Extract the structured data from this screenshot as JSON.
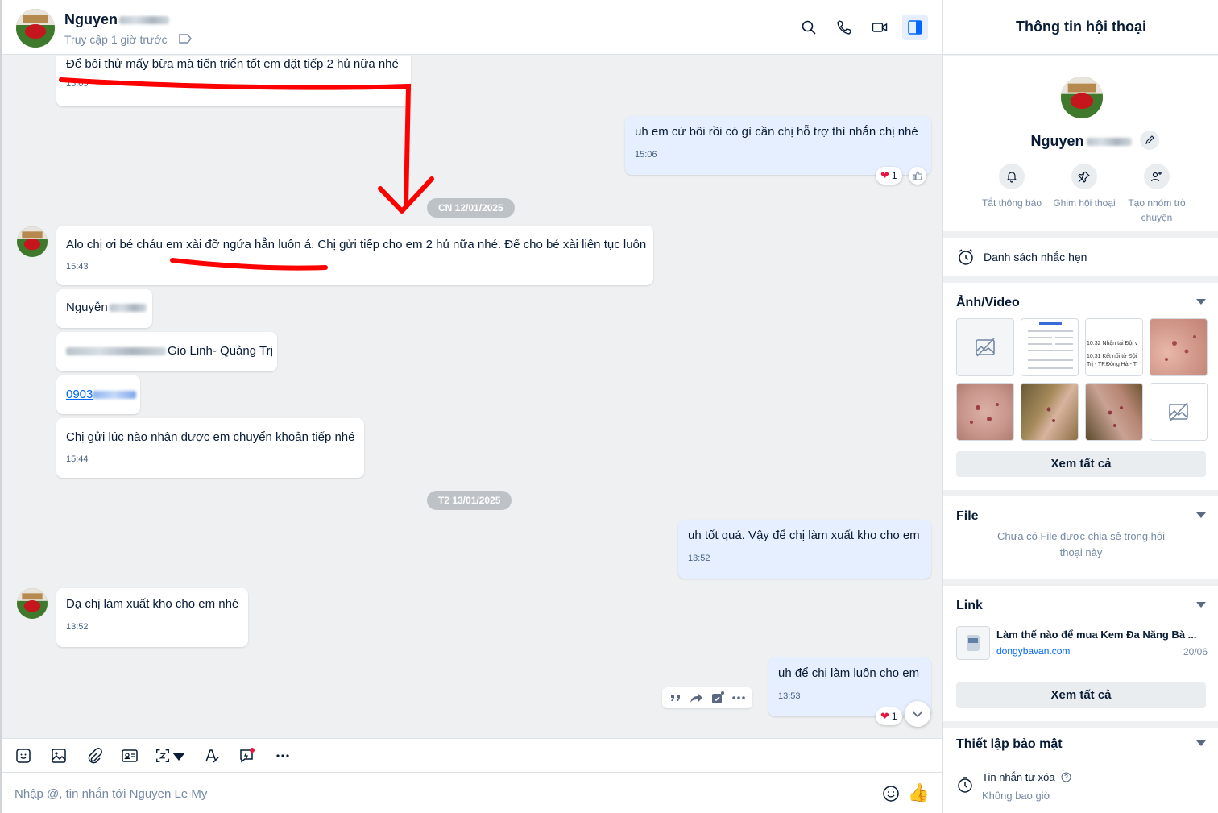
{
  "header": {
    "name": "Nguyen",
    "status": "Truy cập 1 giờ trước"
  },
  "messages": {
    "m1": {
      "text": "Để bôi thử mấy bữa mà tiến triển tốt em đặt tiếp 2 hủ nữa nhé",
      "time": "15:05"
    },
    "m2": {
      "text": "uh em cứ bôi rồi có gì cần chị hỗ trợ thì nhắn chị nhé",
      "time": "15:06",
      "reaction_count": "1"
    },
    "date1": "CN 12/01/2025",
    "m3": {
      "text": "Alo chị ơi bé cháu em xài đỡ ngứa hẳn luôn á. Chị gửi tiếp cho em 2 hủ nữa nhé.  Để cho bé xài liên tục luôn",
      "time": "15:43"
    },
    "m4": {
      "text": "Nguyễn"
    },
    "m5": {
      "text": "Gio Linh- Quảng Trị"
    },
    "m6": {
      "text": "0903"
    },
    "m7": {
      "text": "Chị gửi lúc nào nhận được em chuyển khoản tiếp nhé",
      "time": "15:44"
    },
    "date2": "T2 13/01/2025",
    "m8": {
      "text": "uh tốt quá. Vậy để chị làm xuất kho cho em",
      "time": "13:52"
    },
    "m9": {
      "text": "Dạ chị làm xuất kho cho em nhé",
      "time": "13:52"
    },
    "m10": {
      "text": "uh để chị làm luôn cho em",
      "time": "13:53",
      "reaction_count": "1"
    }
  },
  "composer": {
    "placeholder": "Nhập @, tin nhắn tới Nguyen Le My"
  },
  "panel": {
    "title": "Thông tin hội thoại",
    "name": "Nguyen",
    "actions": [
      {
        "label": "Tắt thông báo",
        "icon": "bell-icon"
      },
      {
        "label": "Ghim hội thoại",
        "icon": "pin-icon"
      },
      {
        "label": "Tạo nhóm trò chuyện",
        "icon": "add-group-icon"
      }
    ],
    "reminder": "Danh sách nhắc hẹn",
    "media": {
      "title": "Ảnh/Video",
      "thumb3_line1": "10:32  Nhận tại Đội v",
      "thumb3_line2": "10:31  Kết nối từ Đội",
      "thumb3_line3": "Trị - TP.Đông Hà - T",
      "view_all": "Xem tất cả"
    },
    "file": {
      "title": "File",
      "empty": "Chưa có File được chia sẻ trong hội thoại này"
    },
    "link": {
      "title": "Link",
      "item_title": "Làm thế nào để mua Kem Đa Năng Bà ...",
      "item_domain": "dongybavan.com",
      "item_date": "20/06",
      "view_all": "Xem tất cả"
    },
    "security": {
      "title": "Thiết lập bảo mật",
      "auto_delete": "Tin nhắn tự xóa",
      "auto_delete_value": "Không bao giờ"
    }
  },
  "colors": {
    "accent": "#0068ff",
    "my_bubble": "#e5efff",
    "annotation": "#ff0000",
    "heart": "#e8163c"
  }
}
